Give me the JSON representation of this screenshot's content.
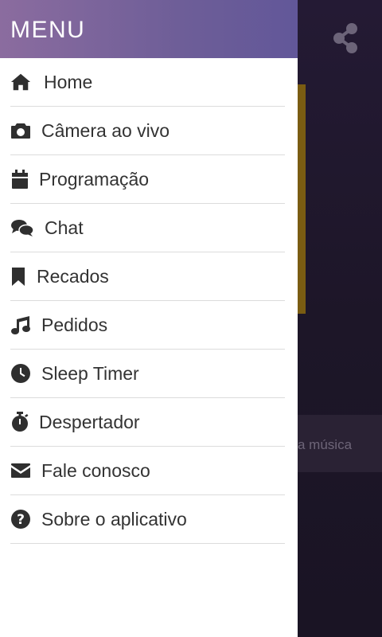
{
  "drawer": {
    "title": "MENU",
    "items": [
      {
        "label": "Home",
        "icon": "home-icon"
      },
      {
        "label": "Câmera ao vivo",
        "icon": "camera-icon"
      },
      {
        "label": "Programação",
        "icon": "calendar-icon"
      },
      {
        "label": "Chat",
        "icon": "chat-icon"
      },
      {
        "label": "Recados",
        "icon": "bookmark-icon"
      },
      {
        "label": "Pedidos",
        "icon": "music-note-icon"
      },
      {
        "label": "Sleep Timer",
        "icon": "clock-icon"
      },
      {
        "label": "Despertador",
        "icon": "stopwatch-icon"
      },
      {
        "label": "Fale conosco",
        "icon": "envelope-icon"
      },
      {
        "label": "Sobre o aplicativo",
        "icon": "question-circle-icon"
      }
    ]
  },
  "background": {
    "song_text": "a música",
    "share_icon": "share-icon"
  },
  "colors": {
    "header_gradient_start": "#8b6c9f",
    "header_gradient_end": "#625799",
    "icon": "#2f2f2f",
    "label": "#333333",
    "divider": "#dcdcdc"
  }
}
